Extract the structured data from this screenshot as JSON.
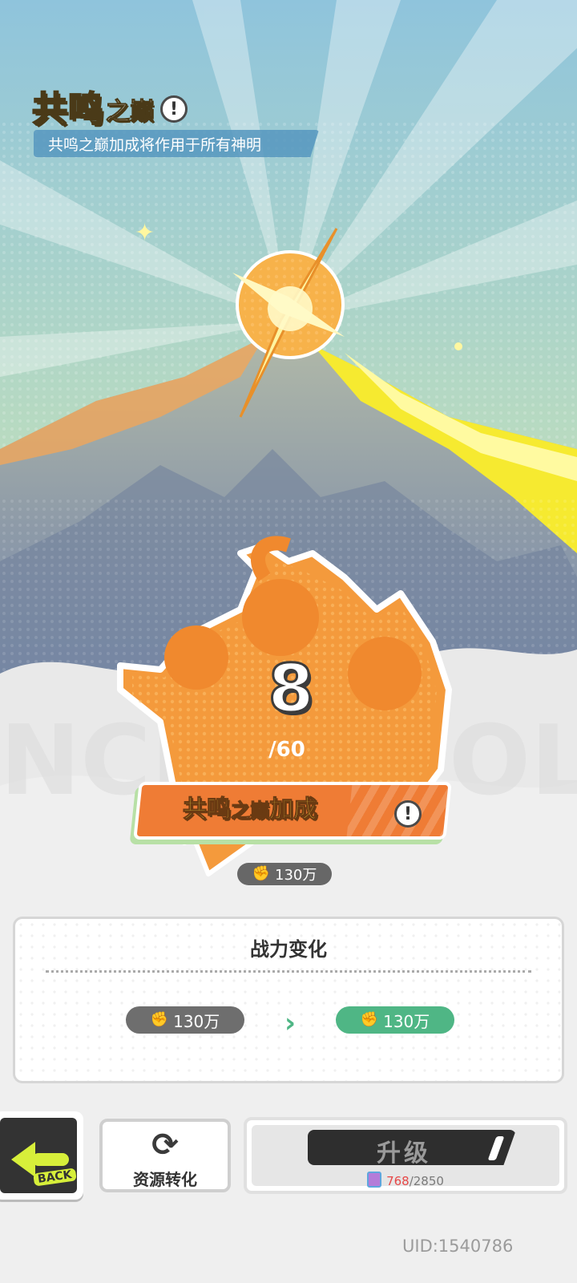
{
  "header": {
    "title_main": "共鸣",
    "title_small": "之巅",
    "info_icon": "exclamation-icon",
    "subtitle": "共鸣之巅加成将作用于所有神明"
  },
  "level": {
    "current": "8",
    "max": "/60"
  },
  "bonus": {
    "label_part1": "共鸣",
    "label_part2": "之巅",
    "label_part3": "加成",
    "info_icon": "exclamation-icon"
  },
  "power": {
    "current": "130万"
  },
  "power_change": {
    "title": "战力变化",
    "before": "130万",
    "after": "130万",
    "arrow_icon": "chevron-right-icon"
  },
  "buttons": {
    "back_label": "BACK",
    "convert_label": "资源转化",
    "upgrade_label": "升级",
    "cost_have": "768",
    "cost_need": "/2850"
  },
  "footer": {
    "uid": "UID:1540786"
  },
  "colors": {
    "accent_orange": "#ef7c35",
    "title_yellow": "#ffe34a",
    "positive_green": "#4fb685",
    "back_green": "#d7ef3a",
    "cost_red": "#e74848"
  }
}
